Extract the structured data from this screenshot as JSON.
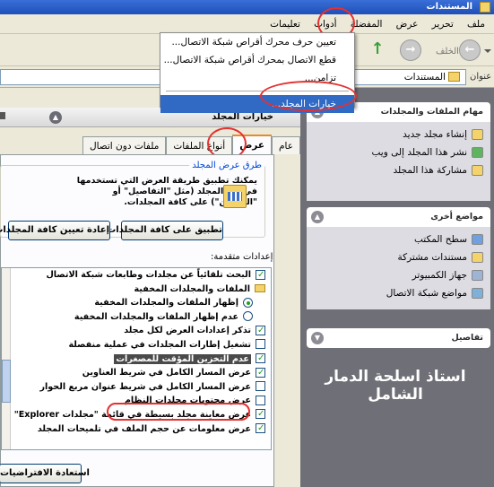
{
  "window": {
    "title": "المستندات"
  },
  "menubar": {
    "items": [
      "ملف",
      "تحرير",
      "عرض",
      "المفضلة",
      "أدوات",
      "تعليمات"
    ]
  },
  "toolbar": {
    "back_label": "الخلف"
  },
  "address": {
    "label": "عنوان",
    "value": "المستندات"
  },
  "tools_menu": {
    "items": [
      "تعيين حرف محرك أقراص شبكة الاتصال...",
      "قطع الاتصال بمحرك أقراص شبكة الاتصال...",
      "تزامن...",
      "خيارات المجلد..."
    ]
  },
  "left_pane": {
    "tasks": {
      "title": "مهام الملفات والمجلدات",
      "items": [
        "إنشاء مجلد جديد",
        "نشر هذا المجلد إلى ويب",
        "مشاركة هذا المجلد"
      ]
    },
    "places": {
      "title": "مواضع أخرى",
      "items": [
        "سطح المكتب",
        "مستندات مشتركة",
        "جهاز الكمبيوتر",
        "مواضع شبكة الاتصال"
      ]
    },
    "details": {
      "title": "تفاصيل"
    },
    "caption": "استاذ اسلحة الدمار الشامل"
  },
  "dialog": {
    "title": "خيارات المجلد",
    "tabs": [
      "عام",
      "عرض",
      "أنواع الملفات",
      "ملفات دون اتصال"
    ],
    "selected_tab": "عرض",
    "folder_views": {
      "legend": "طرق عرض المجلد",
      "description": "يمكنك تطبيق طريقة العرض التي تستخدمها في هذا المجلد (مثل \"التفاصيل\" أو \"العناوين\") على كافة المجلدات.",
      "apply_button": "تطبيق على كافة المجلدات",
      "reset_button": "إعادة تعيين كافة المجلدات"
    },
    "advanced_label": "إعدادات متقدمة:",
    "advanced": [
      {
        "type": "checkbox",
        "checked": true,
        "text": "البحث تلقائياً عن مجلدات وطابعات شبكة الاتصال"
      },
      {
        "type": "folder",
        "text": "الملفات والمجلدات المخفية"
      },
      {
        "type": "radio",
        "checked": true,
        "text": "إظهار الملفات والمجلدات المخفية"
      },
      {
        "type": "radio",
        "checked": false,
        "text": "عدم إظهار الملفات والمجلدات المخفية"
      },
      {
        "type": "checkbox",
        "checked": true,
        "text": "تذكر إعدادات العرض لكل مجلد"
      },
      {
        "type": "checkbox",
        "checked": false,
        "text": "تشغيل إطارات المجلدات في عملية منفصلة"
      },
      {
        "type": "checkbox",
        "checked": true,
        "text": "عدم التخزين المؤقت للمصغرات",
        "highlighted": true
      },
      {
        "type": "checkbox",
        "checked": true,
        "text": "عرض المسار الكامل في شريط العناوين"
      },
      {
        "type": "checkbox",
        "checked": false,
        "text": "عرض المسار الكامل في شريط عنوان مربع الحوار"
      },
      {
        "type": "checkbox",
        "checked": false,
        "text": "عرض محتويات مجلدات النظام"
      },
      {
        "type": "checkbox",
        "checked": true,
        "text": "عرض معاينة مجلد بسيطة في قائمة \"مجلدات Explorer\""
      },
      {
        "type": "checkbox",
        "checked": true,
        "text": "عرض معلومات عن حجم الملف في تلميحات المجلد"
      }
    ],
    "restore_button": "استعادة الافتراضيات"
  },
  "colors": {
    "accent": "#316ac5",
    "annotation": "#e53030",
    "pane_bg": "#6f6f77"
  }
}
